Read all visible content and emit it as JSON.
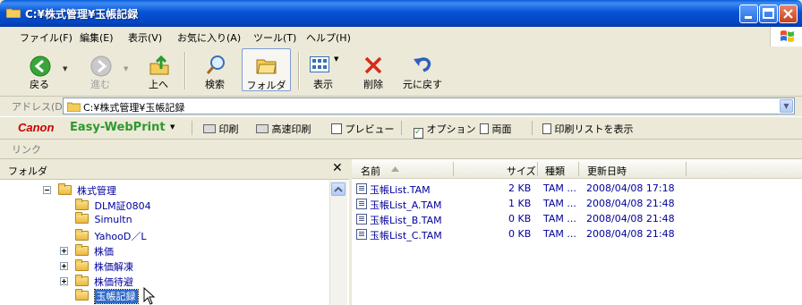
{
  "window": {
    "title": "C:¥株式管理¥玉帳記録",
    "colors": {
      "titlebar": "#0553D6",
      "selection": "#316AC5"
    }
  },
  "menu": [
    "ファイル(F)",
    "編集(E)",
    "表示(V)",
    "お気に入り(A)",
    "ツール(T)",
    "ヘルプ(H)"
  ],
  "toolbar": {
    "back": "戻る",
    "forward": "進む",
    "up": "上へ",
    "search": "検索",
    "folders": "フォルダ",
    "views": "表示",
    "delete": "削除",
    "undo": "元に戻す"
  },
  "address": {
    "label": "アドレス(D)",
    "value": "C:¥株式管理¥玉帳記録"
  },
  "canon_bar": {
    "brand": "Canon",
    "product": "Easy-WebPrint",
    "print": "印刷",
    "fast_print": "高速印刷",
    "preview": "プレビュー",
    "options": "オプション",
    "both_sides": "両面",
    "print_list": "印刷リストを表示"
  },
  "links_bar": {
    "label": "リンク"
  },
  "folder_pane": {
    "title": "フォルダ",
    "close": "✕",
    "tree": [
      {
        "label": "株式管理",
        "expander": "minus"
      },
      {
        "label": "DLM証0804"
      },
      {
        "label": "Simultn"
      },
      {
        "label": "YahooD／L"
      },
      {
        "label": "株価",
        "expander": "plus"
      },
      {
        "label": "株価解凍",
        "expander": "plus"
      },
      {
        "label": "株価待避",
        "expander": "plus"
      },
      {
        "label": "玉帳記録",
        "selected": true
      }
    ]
  },
  "file_list": {
    "columns": [
      "名前",
      "サイズ",
      "種類",
      "更新日時"
    ],
    "rows": [
      {
        "name": "玉帳List.TAM",
        "size": "2 KB",
        "type": "TAM ...",
        "modified": "2008/04/08 17:18"
      },
      {
        "name": "玉帳List_A.TAM",
        "size": "1 KB",
        "type": "TAM ...",
        "modified": "2008/04/08 21:48"
      },
      {
        "name": "玉帳List_B.TAM",
        "size": "0 KB",
        "type": "TAM ...",
        "modified": "2008/04/08 21:48"
      },
      {
        "name": "玉帳List_C.TAM",
        "size": "0 KB",
        "type": "TAM ...",
        "modified": "2008/04/08 21:48"
      }
    ]
  }
}
